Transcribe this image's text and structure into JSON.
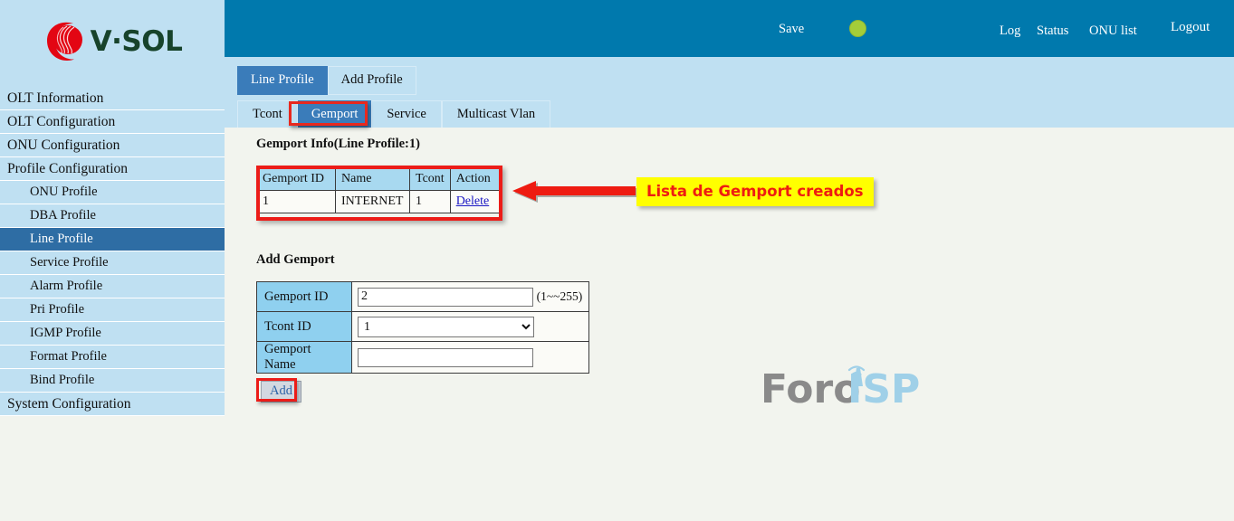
{
  "brand": {
    "logo_text": "V·SOL",
    "logo_icon": "vsol-swirl-logo"
  },
  "header": {
    "save_label": "Save",
    "status_dot_color": "#a4cd39",
    "links": [
      {
        "label": "Log"
      },
      {
        "label": "Status"
      },
      {
        "label": "ONU list"
      },
      {
        "label": "Logout"
      }
    ]
  },
  "tabs": {
    "primary": [
      {
        "label": "Line Profile",
        "active": true
      },
      {
        "label": "Add Profile",
        "active": false
      }
    ],
    "secondary": [
      {
        "label": "Tcont",
        "active": false
      },
      {
        "label": "Gemport",
        "active": true
      },
      {
        "label": "Service",
        "active": false
      },
      {
        "label": "Multicast Vlan",
        "active": false
      }
    ]
  },
  "sidebar": {
    "items": [
      {
        "label": "OLT Information",
        "level": "top",
        "selected": false
      },
      {
        "label": "OLT Configuration",
        "level": "top",
        "selected": false
      },
      {
        "label": "ONU Configuration",
        "level": "top",
        "selected": false
      },
      {
        "label": "Profile Configuration",
        "level": "top",
        "selected": false
      },
      {
        "label": "ONU Profile",
        "level": "sub",
        "selected": false
      },
      {
        "label": "DBA Profile",
        "level": "sub",
        "selected": false
      },
      {
        "label": "Line Profile",
        "level": "sub",
        "selected": true
      },
      {
        "label": "Service Profile",
        "level": "sub",
        "selected": false
      },
      {
        "label": "Alarm Profile",
        "level": "sub",
        "selected": false
      },
      {
        "label": "Pri Profile",
        "level": "sub",
        "selected": false
      },
      {
        "label": "IGMP Profile",
        "level": "sub",
        "selected": false
      },
      {
        "label": "Format Profile",
        "level": "sub",
        "selected": false
      },
      {
        "label": "Bind Profile",
        "level": "sub",
        "selected": false
      },
      {
        "label": "System Configuration",
        "level": "top",
        "selected": false
      }
    ]
  },
  "main": {
    "info_title": "Gemport Info(Line Profile:1)",
    "info_table": {
      "columns": [
        "Gemport ID",
        "Name",
        "Tcont",
        "Action"
      ],
      "rows": [
        {
          "gemport_id": "1",
          "name": "INTERNET",
          "tcont": "1",
          "action": "Delete"
        }
      ]
    },
    "add_title": "Add Gemport",
    "form": {
      "gemport_id_label": "Gemport ID",
      "gemport_id_value": "2",
      "gemport_id_hint": "(1~~255)",
      "tcont_id_label": "Tcont ID",
      "tcont_id_value": "1",
      "tcont_id_options": [
        "1"
      ],
      "gemport_name_label": "Gemport Name",
      "gemport_name_value": "",
      "gemport_name_placeholder": ""
    },
    "add_button": "Add"
  },
  "annotation": {
    "label": "Lista de Gemport creados",
    "label_bg": "#ffff00",
    "label_color": "#ee1c11",
    "highlight_color": "#ec1c18",
    "arrow_icon": "left-arrow-icon"
  },
  "watermark": {
    "text_left": "Foro",
    "text_right": "ISP",
    "icon": "signal-tower-icon"
  }
}
